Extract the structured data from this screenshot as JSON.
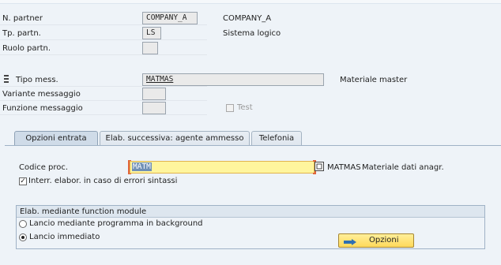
{
  "partner": {
    "partner_no": {
      "label": "N. partner",
      "value": "COMPANY_A",
      "desc": "COMPANY_A"
    },
    "partner_type": {
      "label": "Tp. partn.",
      "value": "LS",
      "desc": "Sistema logico"
    },
    "partner_role": {
      "label": "Ruolo partn.",
      "value": ""
    }
  },
  "message": {
    "type": {
      "label": "Tipo mess.",
      "value": "MATMAS",
      "desc": "Materiale master"
    },
    "variant": {
      "label": "Variante messaggio",
      "value": ""
    },
    "function": {
      "label": "Funzione messaggio",
      "value": ""
    },
    "test_label": "Test"
  },
  "tabs": [
    "Opzioni entrata",
    "Elab. successiva: agente ammesso",
    "Telefonia"
  ],
  "inbound": {
    "process_code": {
      "label": "Codice proc.",
      "value": "MATM",
      "desc1": "MATMAS",
      "desc2": "Materiale dati anagr."
    },
    "cancel_on_syntax_error": {
      "label": "Interr. elabor. in caso di errori sintassi",
      "checked": true
    }
  },
  "processing_group": {
    "title": "Elab. mediante function module",
    "options": [
      {
        "label": "Lancio mediante programma in background",
        "selected": false
      },
      {
        "label": "Lancio immediato",
        "selected": true
      }
    ],
    "button_label": "Opzioni"
  },
  "colors": {
    "accent": "#e1643a",
    "highlight": "#fff59d",
    "background": "#eef3f8"
  }
}
